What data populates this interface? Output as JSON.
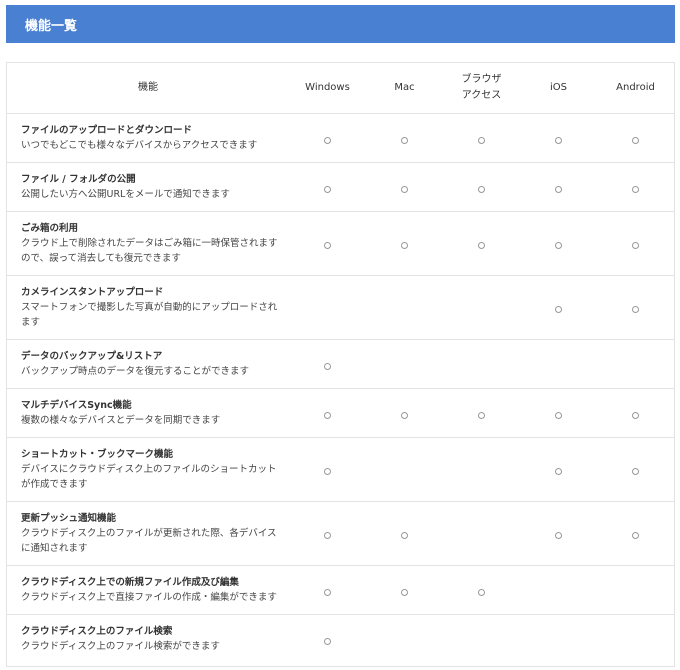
{
  "header": {
    "title": "機能一覧"
  },
  "table": {
    "columns": {
      "feature": "機能",
      "windows": "Windows",
      "mac": "Mac",
      "browser_line1": "ブラウザ",
      "browser_line2": "アクセス",
      "ios": "iOS",
      "android": "Android"
    },
    "rows": [
      {
        "title": "ファイルのアップロードとダウンロード",
        "desc1": "いつでもどこでも様々なデバイスからアクセスできます",
        "desc2": "",
        "support": {
          "windows": true,
          "mac": true,
          "browser": true,
          "ios": true,
          "android": true
        }
      },
      {
        "title": "ファイル / フォルダの公開",
        "desc1": "公開したい方へ公開URLをメールで通知できます",
        "desc2": "",
        "support": {
          "windows": true,
          "mac": true,
          "browser": true,
          "ios": true,
          "android": true
        }
      },
      {
        "title": "ごみ箱の利用",
        "desc1": "クラウド上で削除されたデータはごみ箱に一時保管されます",
        "desc2": "ので、誤って消去しても復元できます",
        "support": {
          "windows": true,
          "mac": true,
          "browser": true,
          "ios": true,
          "android": true
        }
      },
      {
        "title": "カメラインスタントアップロード",
        "desc1": "スマートフォンで撮影した写真が自動的にアップロードされ",
        "desc2": "ます",
        "support": {
          "windows": false,
          "mac": false,
          "browser": false,
          "ios": true,
          "android": true
        }
      },
      {
        "title": "データのバックアップ&リストア",
        "desc1": "バックアップ時点のデータを復元することができます",
        "desc2": "",
        "support": {
          "windows": true,
          "mac": false,
          "browser": false,
          "ios": false,
          "android": false
        }
      },
      {
        "title": "マルチデバイスSync機能",
        "desc1": "複数の様々なデバイスとデータを同期できます",
        "desc2": "",
        "support": {
          "windows": true,
          "mac": true,
          "browser": true,
          "ios": true,
          "android": true
        }
      },
      {
        "title": "ショートカット・ブックマーク機能",
        "desc1": "デバイスにクラウドディスク上のファイルのショートカット",
        "desc2": "が作成できます",
        "support": {
          "windows": true,
          "mac": false,
          "browser": false,
          "ios": true,
          "android": true
        }
      },
      {
        "title": "更新プッシュ通知機能",
        "desc1": "クラウドディスク上のファイルが更新された際、各デバイス",
        "desc2": "に通知されます",
        "support": {
          "windows": true,
          "mac": true,
          "browser": false,
          "ios": true,
          "android": true
        }
      },
      {
        "title": "クラウドディスク上での新規ファイル作成及び編集",
        "desc1": "クラウドディスク上で直接ファイルの作成・編集ができます",
        "desc2": "",
        "support": {
          "windows": true,
          "mac": true,
          "browser": true,
          "ios": false,
          "android": false
        }
      },
      {
        "title": "クラウドディスク上のファイル検索",
        "desc1": "クラウドディスク上のファイル検索ができます",
        "desc2": "",
        "support": {
          "windows": true,
          "mac": false,
          "browser": false,
          "ios": false,
          "android": false
        }
      }
    ]
  }
}
